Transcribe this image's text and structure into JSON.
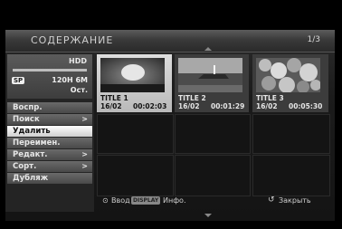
{
  "header": {
    "title": "СОДЕРЖАНИЕ",
    "page": "1/3"
  },
  "disc": {
    "label": "HDD",
    "mode_badge": "SP",
    "time": "120H 6M",
    "remaining": "Ост."
  },
  "menu": [
    {
      "label": "Воспр.",
      "has_arrow": false,
      "selected": false
    },
    {
      "label": "Поиск",
      "has_arrow": true,
      "selected": false
    },
    {
      "label": "Удалить",
      "has_arrow": false,
      "selected": true
    },
    {
      "label": "Переимен.",
      "has_arrow": false,
      "selected": false
    },
    {
      "label": "Редакт.",
      "has_arrow": true,
      "selected": false
    },
    {
      "label": "Сорт.",
      "has_arrow": true,
      "selected": false
    },
    {
      "label": "Дубляж",
      "has_arrow": false,
      "selected": false
    }
  ],
  "titles": [
    {
      "name": "TITLE 1",
      "date": "16/02",
      "duration": "00:02:03",
      "selected": true,
      "thumb": "sun-over-water"
    },
    {
      "name": "TITLE 2",
      "date": "16/02",
      "duration": "00:01:29",
      "selected": false,
      "thumb": "lighthouse-seascape"
    },
    {
      "name": "TITLE 3",
      "date": "16/02",
      "duration": "00:05:30",
      "selected": false,
      "thumb": "flowers"
    }
  ],
  "footer": {
    "enter_label": "Ввод",
    "display_badge": "DISPLAY",
    "info_label": "Инфо.",
    "close_label": "Закрыть"
  },
  "icons": {
    "enter": "enter-icon",
    "close": "return-icon"
  }
}
